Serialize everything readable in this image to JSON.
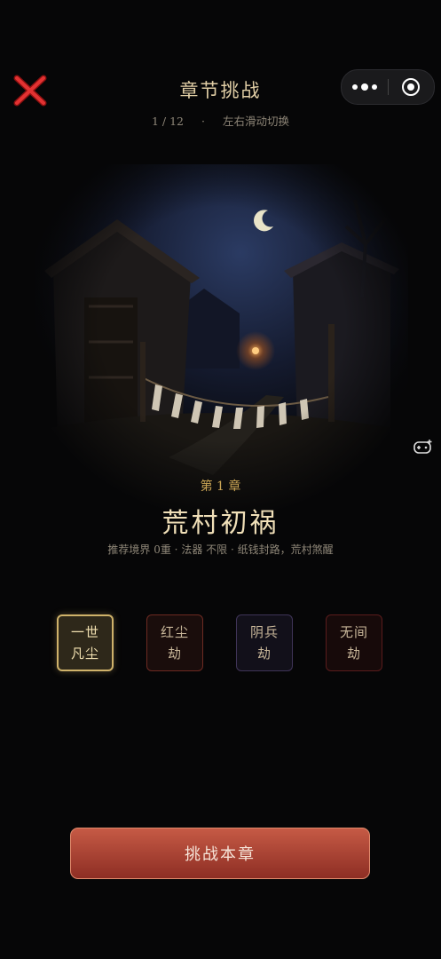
{
  "header": {
    "title": "章节挑战",
    "page_indicator": "1 / 12",
    "separator": "·",
    "hint": "左右滑动切换"
  },
  "chapter": {
    "number": "第 1 章",
    "name": "荒村初祸",
    "info": "推荐境界 0重 · 法器 不限 · 纸钱封路，荒村煞醒"
  },
  "difficulties": [
    {
      "line1": "一世",
      "line2": "凡尘"
    },
    {
      "line1": "红尘",
      "line2": "劫"
    },
    {
      "line1": "阴兵",
      "line2": "劫"
    },
    {
      "line1": "无间",
      "line2": "劫"
    }
  ],
  "selected_difficulty": 0,
  "action": {
    "challenge_label": "挑战本章"
  },
  "colors": {
    "accent_gold": "#c9a454",
    "button_red": "#b14a3a",
    "close_red": "#d42a2a"
  },
  "icons": [
    "close-icon",
    "more-icon",
    "target-icon",
    "game-controller-icon"
  ]
}
